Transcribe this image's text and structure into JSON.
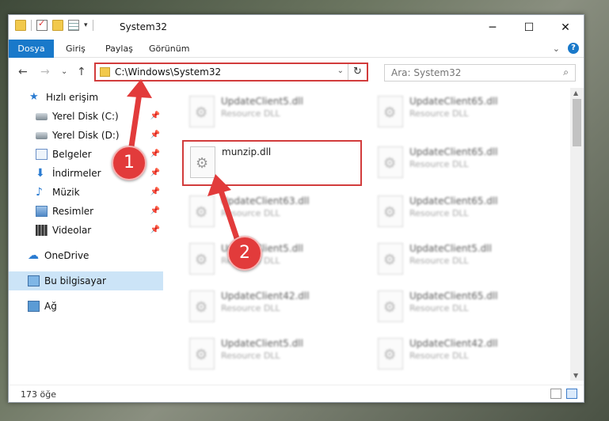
{
  "window": {
    "title": "System32",
    "controls": {
      "minimize": "─",
      "maximize": "☐",
      "close": "✕"
    }
  },
  "ribbon": {
    "tabs": [
      "Dosya",
      "Giriş",
      "Paylaş",
      "Görünüm"
    ]
  },
  "nav": {
    "back": "←",
    "forward": "→",
    "dropdown": "⌄",
    "up": "↑"
  },
  "address": {
    "path": "C:\\Windows\\System32"
  },
  "search": {
    "placeholder": "Ara: System32"
  },
  "sidebar": {
    "items": [
      {
        "label": "Hızlı erişim",
        "icon": "star-icon"
      },
      {
        "label": "Yerel Disk (C:)",
        "icon": "disk-icon",
        "pinned": true
      },
      {
        "label": "Yerel Disk (D:)",
        "icon": "disk-icon",
        "pinned": true
      },
      {
        "label": "Belgeler",
        "icon": "document-icon",
        "pinned": true
      },
      {
        "label": "İndirmeler",
        "icon": "download-icon",
        "pinned": true
      },
      {
        "label": "Müzik",
        "icon": "music-icon",
        "pinned": true
      },
      {
        "label": "Resimler",
        "icon": "picture-icon",
        "pinned": true
      },
      {
        "label": "Videolar",
        "icon": "video-icon",
        "pinned": true
      },
      {
        "label": "OneDrive",
        "icon": "cloud-icon"
      },
      {
        "label": "Bu bilgisayar",
        "icon": "computer-icon",
        "selected": true
      },
      {
        "label": "Ağ",
        "icon": "network-icon"
      }
    ]
  },
  "files": {
    "left": [
      {
        "name": "UpdateClient5.dll",
        "type": "Resource DLL"
      },
      {
        "name": "munzip.dll",
        "type": ""
      },
      {
        "name": "UpdateClient63.dll",
        "type": "Resource DLL"
      },
      {
        "name": "UpdateClient5.dll",
        "type": "Resource DLL"
      },
      {
        "name": "UpdateClient42.dll",
        "type": "Resource DLL"
      },
      {
        "name": "UpdateClient5.dll",
        "type": "Resource DLL"
      }
    ],
    "right": [
      {
        "name": "UpdateClient65.dll",
        "type": "Resource DLL"
      },
      {
        "name": "UpdateClient65.dll",
        "type": "Resource DLL"
      },
      {
        "name": "UpdateClient65.dll",
        "type": "Resource DLL"
      },
      {
        "name": "UpdateClient5.dll",
        "type": "Resource DLL"
      },
      {
        "name": "UpdateClient65.dll",
        "type": "Resource DLL"
      },
      {
        "name": "UpdateClient42.dll",
        "type": "Resource DLL"
      }
    ]
  },
  "status": {
    "count": "173 öğe"
  },
  "annotations": {
    "step1": "1",
    "step2": "2"
  },
  "colors": {
    "accent": "#1979ca",
    "highlight": "#d23c3c",
    "badge": "#e23b3b"
  }
}
